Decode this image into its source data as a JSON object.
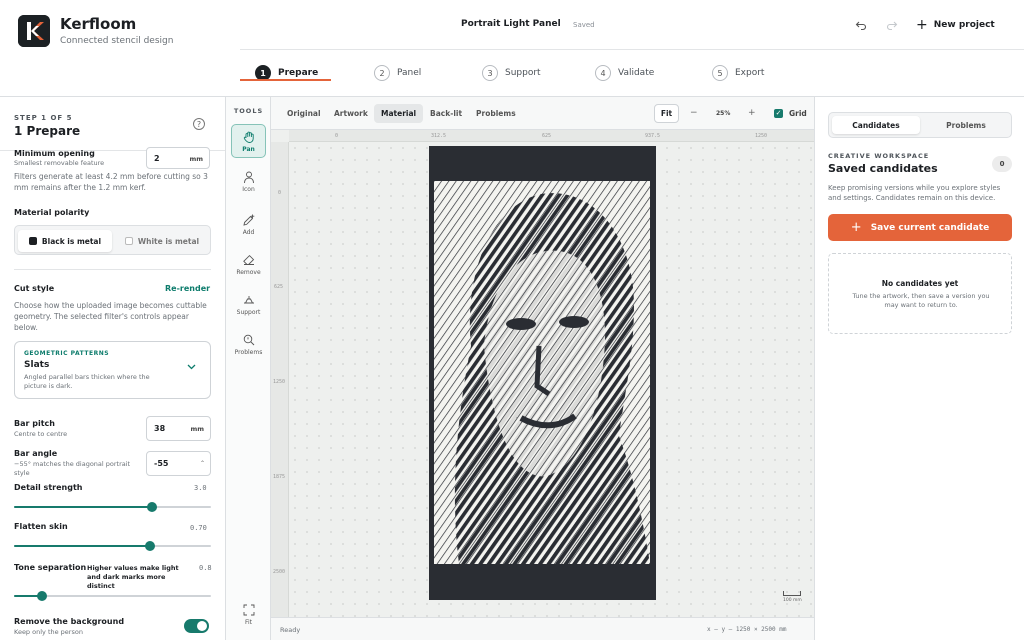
{
  "app": {
    "name": "Kerfloom",
    "tagline": "Connected stencil design",
    "logo_letter": "K"
  },
  "document": {
    "title": "Portrait Light Panel",
    "status": "Saved"
  },
  "header": {
    "undo_icon": "undo-icon",
    "redo_icon": "redo-icon",
    "new_project_label": "New project"
  },
  "steps": [
    {
      "num": "1",
      "label": "Prepare"
    },
    {
      "num": "2",
      "label": "Panel"
    },
    {
      "num": "3",
      "label": "Support"
    },
    {
      "num": "4",
      "label": "Validate"
    },
    {
      "num": "5",
      "label": "Export"
    }
  ],
  "left": {
    "step_of": "STEP 1 OF 5",
    "step_name": "1 Prepare",
    "min_opening": {
      "label": "Minimum opening",
      "sub": "Smallest removable feature",
      "value": "2",
      "unit": "mm"
    },
    "filter_note": "Filters generate at least 4.2 mm before cutting so 3 mm remains after the 1.2 mm kerf.",
    "polarity": {
      "label": "Material polarity",
      "option_on": "Black is metal",
      "option_off": "White is metal"
    },
    "cut_style": {
      "label": "Cut style",
      "rerender": "Re-render",
      "desc": "Choose how the uploaded image becomes cuttable geometry. The selected filter's controls appear below.",
      "category": "GEOMETRIC PATTERNS",
      "name": "Slats",
      "filter_desc": "Angled parallel bars thicken where the picture is dark."
    },
    "bar_pitch": {
      "label": "Bar pitch",
      "sub": "Centre to centre",
      "value": "38",
      "unit": "mm"
    },
    "bar_angle": {
      "label": "Bar angle",
      "sub": "−55° matches the diagonal portrait style",
      "value": "-55"
    },
    "detail_strength": {
      "label": "Detail strength",
      "value": "3.0",
      "fraction": 0.7
    },
    "flatten_skin": {
      "label": "Flatten skin",
      "value": "0.70",
      "fraction": 0.69
    },
    "tone_separation": {
      "label": "Tone separation",
      "hint": "Higher values make light and dark marks more distinct",
      "value": "0.8",
      "fraction": 0.14
    },
    "remove_bg": {
      "label": "Remove the background",
      "sub": "Keep only the person",
      "on": true
    }
  },
  "tools": {
    "title": "TOOLS",
    "items": [
      {
        "label": "Pan",
        "icon": "hand-icon"
      },
      {
        "label": "Icon",
        "icon": "person-icon"
      },
      {
        "label": "Add",
        "icon": "pencil-plus-icon"
      },
      {
        "label": "Remove",
        "icon": "eraser-icon"
      },
      {
        "label": "Support",
        "icon": "support-icon"
      },
      {
        "label": "Problems",
        "icon": "search-icon"
      },
      {
        "label": "Fit",
        "icon": "fit-icon"
      }
    ]
  },
  "canvas": {
    "tabs": [
      "Original",
      "Artwork",
      "Material",
      "Back-lit",
      "Problems"
    ],
    "active_tab": "Material",
    "fit_label": "Fit",
    "zoom": "25%",
    "grid_label": "Grid",
    "grid_on": true,
    "ruler_h": [
      "0",
      "312.5",
      "625",
      "937.5",
      "1250"
    ],
    "ruler_v": [
      "0",
      "625",
      "1250",
      "1875",
      "2500"
    ],
    "status_ready": "Ready",
    "status_coords": "x –   y –   1250 × 2500 mm",
    "scale_label": "100 mm"
  },
  "right": {
    "tab_on": "Candidates",
    "tab_off": "Problems",
    "eyebrow": "CREATIVE WORKSPACE",
    "title": "Saved candidates",
    "count": "0",
    "desc": "Keep promising versions while you explore styles and settings. Candidates remain on this device.",
    "save_label": "Save current candidate",
    "empty_title": "No candidates yet",
    "empty_desc": "Tune the artwork, then save a version you may want to return to."
  },
  "colors": {
    "accent": "#e4643a",
    "teal": "#177a6c",
    "dark": "#1c2124"
  }
}
